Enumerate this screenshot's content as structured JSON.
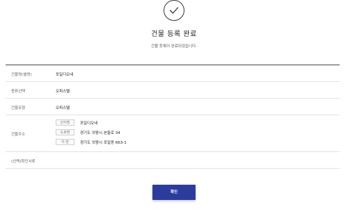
{
  "header": {
    "title": "건물 등록 완료",
    "subtitle": "건물 등록이 완료되었습니다."
  },
  "details": {
    "building_name_label": "건물명(별명)",
    "building_name_value": "포일디오네",
    "type_select_label": "종류선택",
    "type_select_value": "오피스텔",
    "building_type_label": "건물유형",
    "building_type_value": "오피스텔",
    "address_label": "건물주소",
    "address": {
      "complex_badge": "단지명",
      "complex_value": "포일디오네",
      "road_badge": "도로명",
      "road_value": "경기도 의왕시 본들로 34",
      "lot_badge": "지 번",
      "lot_value": "경기도 의왕시 포일동 663-1"
    },
    "optional_docs_label": "(선택)확인서류"
  },
  "actions": {
    "confirm_label": "확인"
  },
  "colors": {
    "accent": "#2c3c9e"
  },
  "icons": {
    "success": "check-circle-icon"
  }
}
